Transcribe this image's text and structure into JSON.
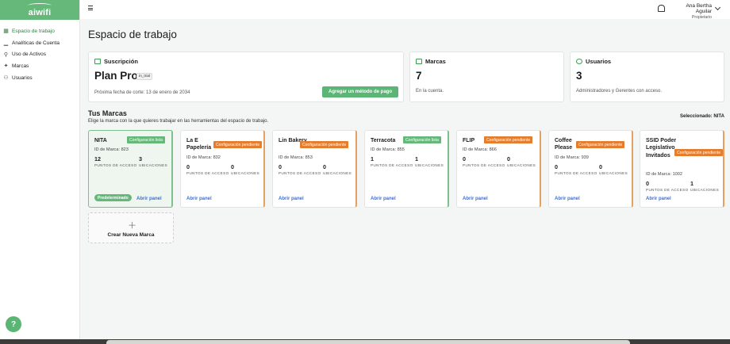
{
  "brand": {
    "logo_text": "aiwifi",
    "accent": "#66b77a"
  },
  "sidebar": {
    "items": [
      {
        "label": "Espacio de trabajo",
        "icon": "grid-icon"
      },
      {
        "label": "Analíticas de Cuenta",
        "icon": "chart-icon"
      },
      {
        "label": "Uso de Activos",
        "icon": "key-icon"
      },
      {
        "label": "Marcas",
        "icon": "badge-icon"
      },
      {
        "label": "Usuarios",
        "icon": "user-icon"
      }
    ],
    "help_label": "?"
  },
  "header": {
    "user_name": "Ana Bertha Aguilar",
    "user_role": "Propietario"
  },
  "main": {
    "title": "Espacio de trabajo",
    "subscription": {
      "heading": "Suscripción",
      "plan": "Plan Pro",
      "tag": "in_trial",
      "next_cut": "Próxima fecha de corte: 13 de enero de 2034",
      "button": "Agregar un método de pago"
    },
    "brands_panel": {
      "heading": "Marcas",
      "count": "7",
      "note": "En la cuenta."
    },
    "users_panel": {
      "heading": "Usuarios",
      "count": "3",
      "note": "Administradores y Gerentes con acceso."
    },
    "brands_section": {
      "title": "Tus Marcas",
      "subtitle": "Elige la marca con la que quieres trabajar en las herramientas del espacio de trabajo.",
      "selected": "Seleccionado: NITA"
    },
    "stat_labels": {
      "access": "PUNTOS DE ACCESO",
      "locations": "UBICACIONES"
    },
    "default_label": "Predeterminado",
    "open_label": "Abrir panel",
    "cards": [
      {
        "name": "NITA",
        "status": "Configuración lista",
        "id": "ID de Marca: 823",
        "access": "12",
        "locations": "3"
      },
      {
        "name": "La E Papelería",
        "status": "Configuración pendiente",
        "id": "ID de Marca: 832",
        "access": "0",
        "locations": "0"
      },
      {
        "name": "Lin Bakery",
        "status": "Configuración pendiente",
        "id": "ID de Marca: 853",
        "access": "0",
        "locations": "0"
      },
      {
        "name": "Terracota",
        "status": "Configuración lista",
        "id": "ID de Marca: 855",
        "access": "1",
        "locations": "1"
      },
      {
        "name": "FLIP",
        "status": "Configuración pendiente",
        "id": "ID de Marca: 866",
        "access": "0",
        "locations": "0"
      },
      {
        "name": "Coffee Please",
        "status": "Configuración pendiente",
        "id": "ID de Marca: 939",
        "access": "0",
        "locations": "0"
      },
      {
        "name": "SSID Poder Legislativo Invitados",
        "status": "Configuración pendiente",
        "id": "ID de Marca: 1002",
        "access": "0",
        "locations": "1"
      }
    ],
    "new_brand": "Crear Nueva Marca"
  }
}
